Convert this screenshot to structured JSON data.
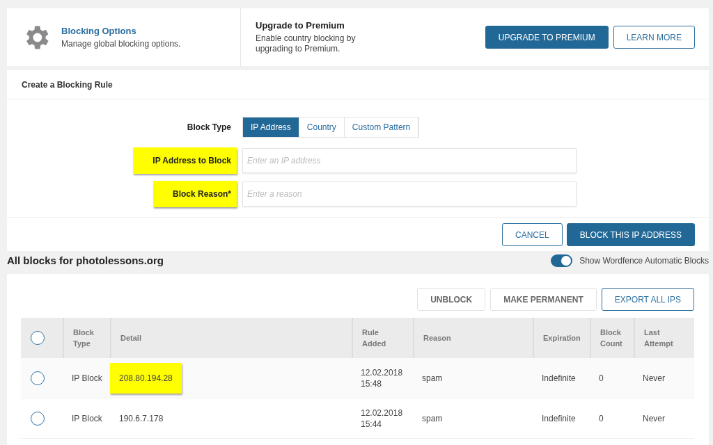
{
  "options": {
    "title": "Blocking Options",
    "subtitle": "Manage global blocking options."
  },
  "premium": {
    "title": "Upgrade to Premium",
    "text": "Enable country blocking by upgrading to Premium.",
    "buttons": [
      {
        "label": "UPGRADE TO PREMIUM",
        "kind": "primary"
      },
      {
        "label": "LEARN MORE",
        "kind": "outline"
      }
    ]
  },
  "rule_form": {
    "title": "Create a Blocking Rule",
    "block_type_label": "Block Type",
    "tabs": [
      {
        "label": "IP Address",
        "selected": true
      },
      {
        "label": "Country",
        "selected": false
      },
      {
        "label": "Custom Pattern",
        "selected": false
      }
    ],
    "fields": [
      {
        "label": "IP Address to Block",
        "placeholder": "Enter an IP address",
        "highlighted": true
      },
      {
        "label": "Block Reason*",
        "placeholder": "Enter a reason",
        "highlighted": true
      }
    ],
    "buttons": [
      {
        "label": "CANCEL",
        "kind": "outline"
      },
      {
        "label": "BLOCK THIS IP ADDRESS",
        "kind": "primary"
      }
    ]
  },
  "blocks": {
    "title": "All blocks for photolessons.org",
    "toggle": {
      "label": "Show Wordfence Automatic Blocks",
      "on": true
    },
    "buttons": [
      {
        "label": "UNBLOCK",
        "kind": "plain"
      },
      {
        "label": "MAKE PERMANENT",
        "kind": "plain"
      },
      {
        "label": "EXPORT ALL IPS",
        "kind": "outline"
      }
    ],
    "select_all": {
      "selected": false
    },
    "columns": [
      "Block Type",
      "Detail",
      "Rule Added",
      "Reason",
      "Expiration",
      "Block Count",
      "Last Attempt"
    ],
    "rows": [
      {
        "selected": false,
        "cells": [
          "IP Block",
          "208.80.194.28",
          "12.02.2018 15:48",
          "spam",
          "Indefinite",
          "0",
          "Never"
        ],
        "highlighted": true
      },
      {
        "selected": false,
        "cells": [
          "IP Block",
          "190.6.7.178",
          "12.02.2018 15:44",
          "spam",
          "Indefinite",
          "0",
          "Never"
        ],
        "highlighted": false
      }
    ]
  }
}
